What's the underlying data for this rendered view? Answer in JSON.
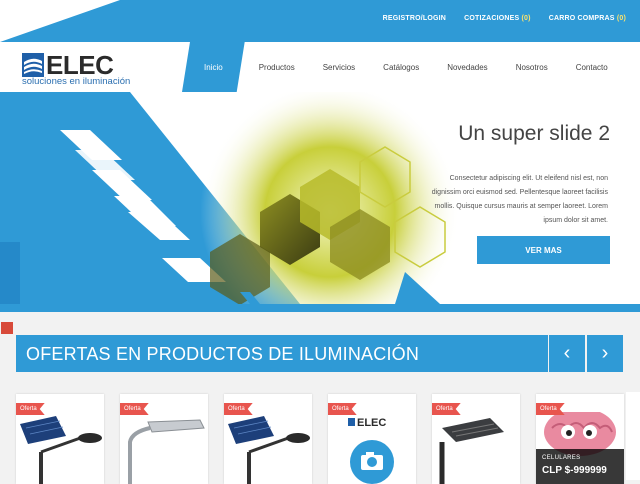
{
  "topbar": {
    "links": [
      {
        "label": "REGISTRO/LOGIN"
      },
      {
        "label": "COTIZACIONES",
        "count": "(0)"
      },
      {
        "label": "CARRO COMPRAS",
        "count": "(0)"
      }
    ]
  },
  "logo": {
    "word": "ELEC",
    "tagline": "soluciones en iluminación"
  },
  "nav": {
    "items": [
      {
        "label": "Inicio",
        "active": true
      },
      {
        "label": "Productos"
      },
      {
        "label": "Servicios"
      },
      {
        "label": "Catálogos"
      },
      {
        "label": "Novedades"
      },
      {
        "label": "Nosotros"
      },
      {
        "label": "Contacto"
      }
    ]
  },
  "slide": {
    "title": "Un super slide 2",
    "text": "Consectetur adipiscing elit. Ut eleifend nisl est, non dignissim orci euismod sed. Pellentesque laoreet facilisis mollis. Quisque cursus mauris at semper laoreet. Lorem ipsum dolor sit amet.",
    "button": "VER MAS"
  },
  "offers": {
    "title": "OFERTAS EN PRODUCTOS DE ILUMINACIÓN",
    "prev": "‹",
    "next": "›",
    "products": [
      {
        "badge": "Oferta",
        "image": "solar-street-lamp"
      },
      {
        "badge": "Oferta",
        "image": "street-lamp"
      },
      {
        "badge": "Oferta",
        "image": "solar-street-lamp"
      },
      {
        "badge": "Oferta",
        "image": "elec-camera-placeholder",
        "brand": "ELEC"
      },
      {
        "badge": "Oferta",
        "image": "led-street-lamp"
      },
      {
        "badge": "Oferta",
        "image": "brain-mascot",
        "category": "CELULARES",
        "price": "CLP $-999999"
      }
    ]
  },
  "colors": {
    "accent": "#2f9ad6",
    "ribbon": "#e8554e",
    "text": "#444444"
  }
}
